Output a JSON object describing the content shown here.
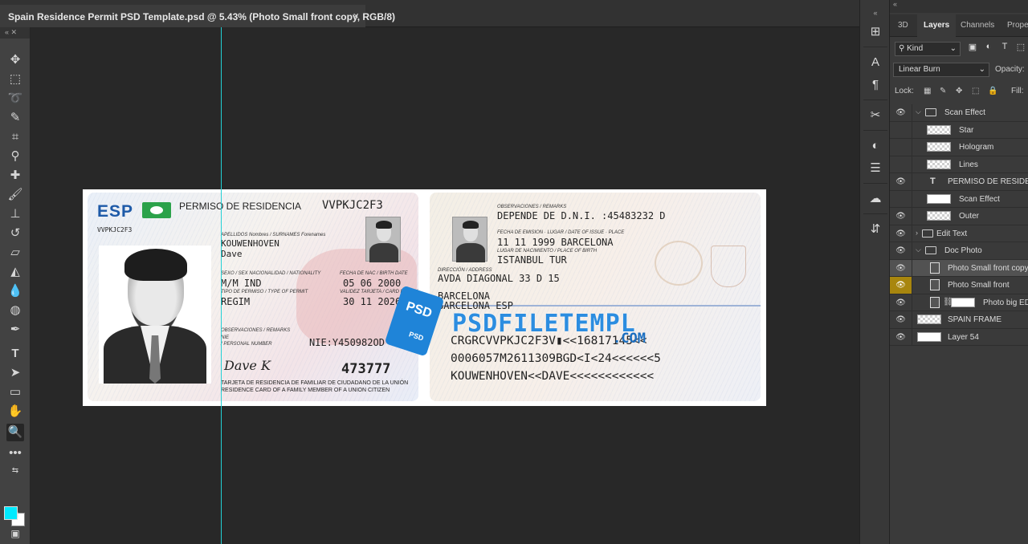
{
  "document_tab": {
    "title": "Spain Residence Permit PSD Template.psd @ 5.43% (Photo Small front copy, RGB/8)",
    "close": "×"
  },
  "toolbar": {
    "tools": [
      "move",
      "marquee",
      "lasso",
      "quick-select",
      "crop",
      "eyedropper",
      "healing",
      "brush",
      "stamp",
      "history-brush",
      "eraser",
      "paint-bucket",
      "blur",
      "dodge",
      "pen",
      "type",
      "path-select",
      "rectangle",
      "hand",
      "zoom",
      "more",
      "swap"
    ],
    "foreground_color": "#00eaff",
    "background_color": "#ffffff"
  },
  "card_front": {
    "country": "ESP",
    "doc_title": "PERMISO DE RESIDENCIA",
    "doc_code": "VVPKJC2F3",
    "doc_code_small": "VVPKJC2F3",
    "surname_label": "APELLIDOS Nombres / SURNAMES Forenames",
    "surname": "KOUWENHOVEN",
    "forename": "Dave",
    "sex_label": "SEXO / SEX   NACIONALIDAD / NATIONALITY",
    "sex_nat": "M/M IND",
    "dob_label": "FECHA DE NAC / BIRTH DATE",
    "dob": "05 06 2000",
    "permit_label": "TIPO DE PERMISO / TYPE OF PERMIT",
    "permit": "REGIM",
    "expiry_label": "VALIDEZ TARJETA / CARD EXPIRY",
    "expiry": "30 11 2026",
    "remarks_label": "OBSERVACIONES / REMARKS",
    "nie_small": "NIE",
    "personal_label": "/ PERSONAL NUMBER",
    "nie": "NIE:Y450982OD",
    "signature": "Dave K",
    "number": "473777",
    "footer1": "TARJETA DE RESIDENCIA DE FAMILIAR DE CIUDADANO DE LA UNIÓN",
    "footer2": "RESIDENCE CARD OF A FAMILY MEMBER OF A UNION CITIZEN"
  },
  "card_back": {
    "remarks_label": "OBSERVACIONES / REMARKS",
    "remarks": "DEPENDE DE D.N.I. :45483232 D",
    "issue_label": "FECHA DE EMISION · LUGAR / DATE OF ISSUE · PLACE",
    "issue": "11 11 1999 BARCELONA",
    "birthplace_label": "LUGAR DE NACIMIENTO / PLACE OF BIRTH",
    "birthplace": "ISTANBUL TUR",
    "address_label": "DIRECCIÓN / ADDRESS",
    "address1": "AVDA DIAGONAL 33 D 15",
    "address2": "BARCELONA",
    "address3": "BARCELONA    ESP",
    "mrz1": "CRGRCVVPKJC2F3V▮<<16817145<<",
    "mrz2": "0006057M2611309BGD<I<24<<<<<<5",
    "mrz3": "KOUWENHOVEN<<DAVE<<<<<<<<<<<<"
  },
  "watermark": {
    "text": "PSDFILETEMPL",
    "com": ".COM",
    "badge1": "PSD",
    "badge2": "PSD"
  },
  "panel": {
    "tabs": [
      "3D",
      "Layers",
      "Channels",
      "Prope"
    ],
    "kind": "Kind",
    "blend_mode": "Linear Burn",
    "opacity_label": "Opacity:",
    "lock_label": "Lock:",
    "fill_label": "Fill:",
    "layers": [
      {
        "name": "Scan Effect",
        "type": "group",
        "visible": true,
        "indent": 0
      },
      {
        "name": "Star",
        "type": "pixel",
        "visible": false,
        "indent": 1
      },
      {
        "name": "Hologram",
        "type": "pixel",
        "visible": false,
        "indent": 1
      },
      {
        "name": "Lines",
        "type": "pixel",
        "visible": false,
        "indent": 1
      },
      {
        "name": "PERMISO DE RESIDENCIA",
        "type": "text",
        "visible": true,
        "indent": 1
      },
      {
        "name": "Scan Effect",
        "type": "pixel",
        "visible": false,
        "indent": 1
      },
      {
        "name": "Outer",
        "type": "pixel",
        "visible": true,
        "indent": 1
      },
      {
        "name": "Edit Text",
        "type": "group-closed",
        "visible": true,
        "indent": 0
      },
      {
        "name": "Doc Photo",
        "type": "group",
        "visible": true,
        "indent": 0
      },
      {
        "name": "Photo Small front copy",
        "type": "smart",
        "visible": true,
        "indent": 1,
        "selected": true
      },
      {
        "name": "Photo Small front",
        "type": "smart",
        "visible": true,
        "indent": 1,
        "highlight": true
      },
      {
        "name": "Photo big EDIT",
        "type": "smart-mask",
        "visible": true,
        "indent": 1
      },
      {
        "name": "SPAIN FRAME",
        "type": "pixel",
        "visible": true,
        "indent": 0
      },
      {
        "name": "Layer 54",
        "type": "white",
        "visible": true,
        "indent": 0
      }
    ]
  }
}
